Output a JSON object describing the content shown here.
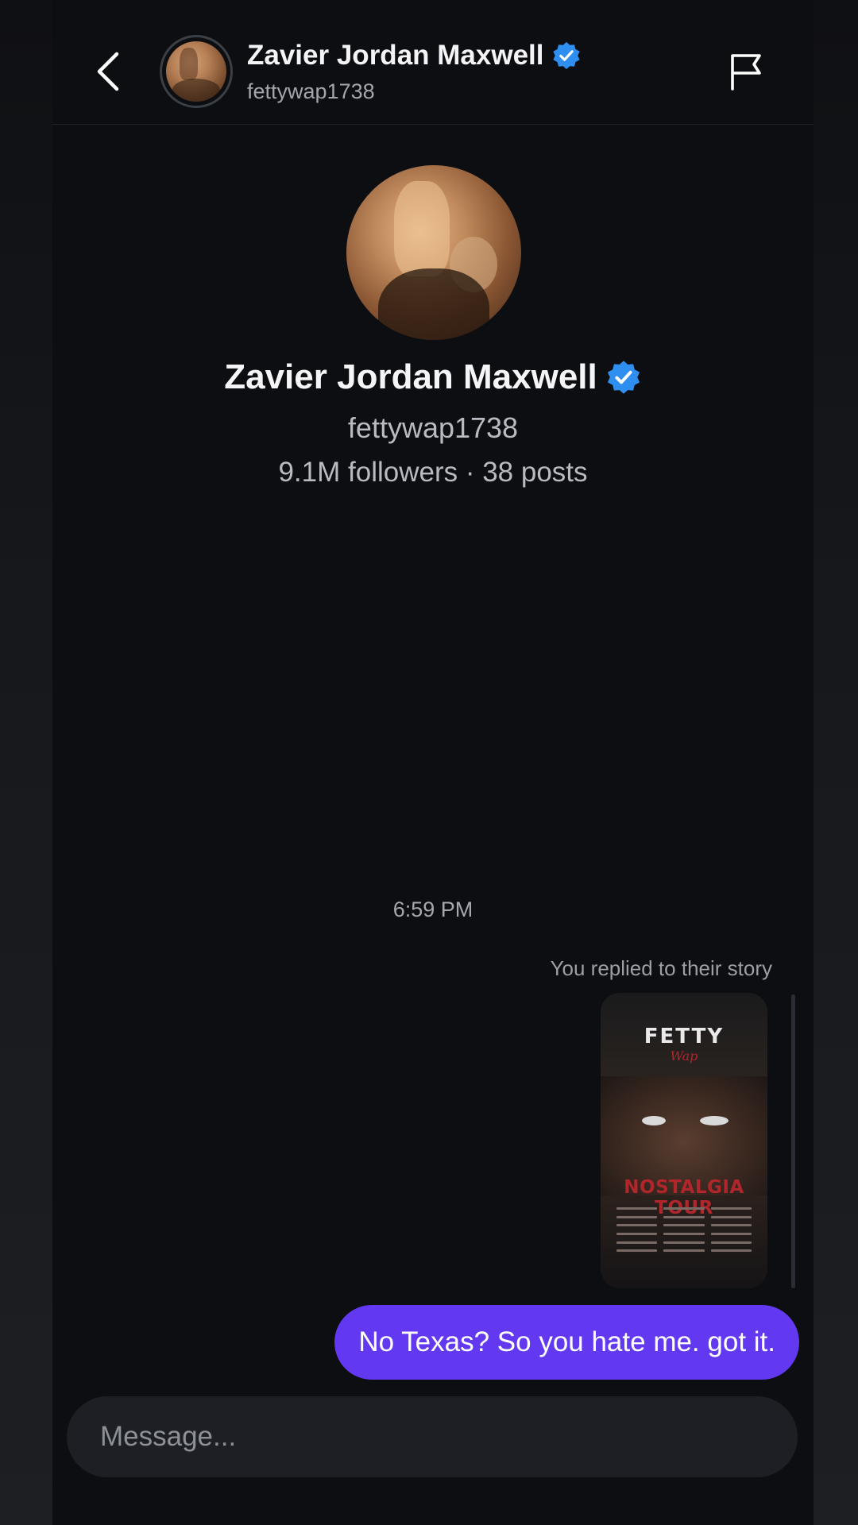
{
  "header": {
    "name": "Zavier Jordan Maxwell",
    "handle": "fettywap1738"
  },
  "profile": {
    "name": "Zavier Jordan Maxwell",
    "handle": "fettywap1738",
    "stats": "9.1M followers · 38 posts"
  },
  "conversation": {
    "timestamp": "6:59 PM",
    "story_caption": "You replied to their story",
    "story": {
      "brand": "FETTY",
      "script": "Wap",
      "tour": "NOSTALGIA TOUR"
    },
    "message": "No Texas? So you hate me. got it."
  },
  "composer": {
    "placeholder": "Message..."
  },
  "colors": {
    "background": "#0c0e12",
    "accent_bubble": "#6239f0",
    "verified": "#2f8ff0"
  }
}
